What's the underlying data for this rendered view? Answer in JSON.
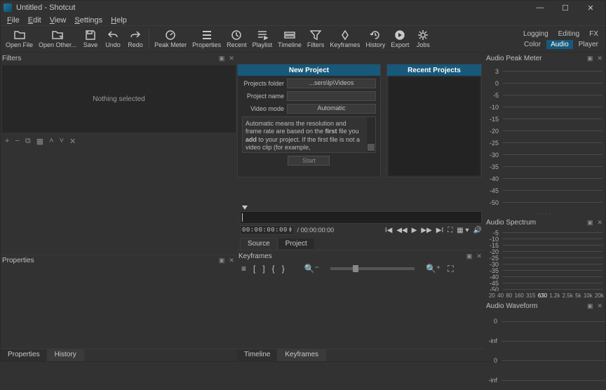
{
  "window": {
    "title": "Untitled - Shotcut"
  },
  "menubar": [
    "File",
    "Edit",
    "View",
    "Settings",
    "Help"
  ],
  "toolbar": [
    {
      "id": "open-file",
      "label": "Open File",
      "icon": "open"
    },
    {
      "id": "open-other",
      "label": "Open Other...",
      "icon": "open-other"
    },
    {
      "id": "save",
      "label": "Save",
      "icon": "save"
    },
    {
      "id": "undo",
      "label": "Undo",
      "icon": "undo"
    },
    {
      "id": "redo",
      "label": "Redo",
      "icon": "redo"
    },
    {
      "id": "peak-meter",
      "label": "Peak Meter",
      "icon": "peak"
    },
    {
      "id": "properties",
      "label": "Properties",
      "icon": "props"
    },
    {
      "id": "recent",
      "label": "Recent",
      "icon": "recent"
    },
    {
      "id": "playlist",
      "label": "Playlist",
      "icon": "playlist"
    },
    {
      "id": "timeline",
      "label": "Timeline",
      "icon": "timeline"
    },
    {
      "id": "filters",
      "label": "Filters",
      "icon": "filters"
    },
    {
      "id": "keyframes",
      "label": "Keyframes",
      "icon": "keyframes"
    },
    {
      "id": "history",
      "label": "History",
      "icon": "history"
    },
    {
      "id": "export",
      "label": "Export",
      "icon": "export"
    },
    {
      "id": "jobs",
      "label": "Jobs",
      "icon": "jobs"
    }
  ],
  "header_tabs": {
    "row1": [
      "Logging",
      "Editing",
      "FX"
    ],
    "row2": [
      "Color",
      "Audio",
      "Player"
    ],
    "active_row2_idx": 1
  },
  "filters_panel": {
    "title": "Filters",
    "empty_text": "Nothing selected"
  },
  "properties_panel": {
    "title": "Properties"
  },
  "keyframes_panel": {
    "title": "Keyframes"
  },
  "bottom_tabs_left": [
    "Properties",
    "History"
  ],
  "bottom_tabs_left_active_idx": 1,
  "bottom_tabs_mid": [
    "Timeline",
    "Keyframes"
  ],
  "bottom_tabs_mid_active_idx": 1,
  "new_project": {
    "title": "New Project",
    "folder_label": "Projects folder",
    "folder_value": "...sers\\lp\\Videos",
    "name_label": "Project name",
    "name_value": "",
    "mode_label": "Video mode",
    "mode_value": "Automatic",
    "desc_prefix": "Automatic means the resolution and frame rate are based on the ",
    "desc_bold1": "first",
    "desc_mid": " file you ",
    "desc_bold2": "add",
    "desc_suffix": " to your project. If the first file is not a video clip (for example,",
    "start": "Start"
  },
  "recent_projects": {
    "title": "Recent Projects"
  },
  "player": {
    "tc_current": "00:00:00:00",
    "tc_total": "/ 00:00:00:00",
    "tabs": [
      "Source",
      "Project"
    ],
    "active_tab_idx": 0
  },
  "audio_peak": {
    "title": "Audio Peak Meter",
    "marks": [
      "3",
      "0",
      "-5",
      "-10",
      "-15",
      "-20",
      "-25",
      "-30",
      "-35",
      "-40",
      "-45",
      "-50"
    ]
  },
  "audio_spectrum": {
    "title": "Audio Spectrum",
    "marks": [
      "-5",
      "-10",
      "-15",
      "-20",
      "-25",
      "-30",
      "-35",
      "-40",
      "-45",
      "-50"
    ],
    "axis": [
      "20",
      "40",
      "80",
      "160",
      "315",
      "630",
      "1.2k",
      "2.5k",
      "5k",
      "10k",
      "20k"
    ],
    "axis_active": "630"
  },
  "audio_waveform": {
    "title": "Audio Waveform",
    "marks": [
      "0",
      "-inf",
      "0",
      "-inf"
    ]
  }
}
